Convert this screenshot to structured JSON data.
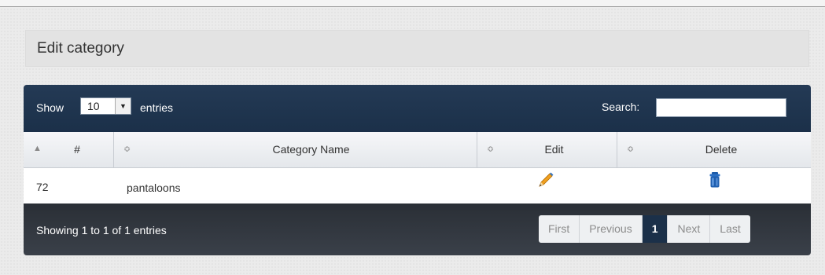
{
  "page_title": "Edit category",
  "table_controls": {
    "show_label": "Show",
    "length_value": "10",
    "entries_label": "entries",
    "search_label": "Search:",
    "search_value": ""
  },
  "columns": {
    "id": "#",
    "category_name": "Category Name",
    "edit": "Edit",
    "delete": "Delete"
  },
  "rows": [
    {
      "id": "72",
      "category_name": "pantaloons",
      "edit_icon": "pencil-icon",
      "delete_icon": "trash-can-icon"
    }
  ],
  "footer": {
    "info": "Showing 1 to 1 of 1 entries",
    "pagination": {
      "first": "First",
      "previous": "Previous",
      "current": "1",
      "next": "Next",
      "last": "Last"
    }
  },
  "colors": {
    "header_bg": "#1b3049",
    "footer_bg": "#333941",
    "active_page": "#1b3049"
  }
}
